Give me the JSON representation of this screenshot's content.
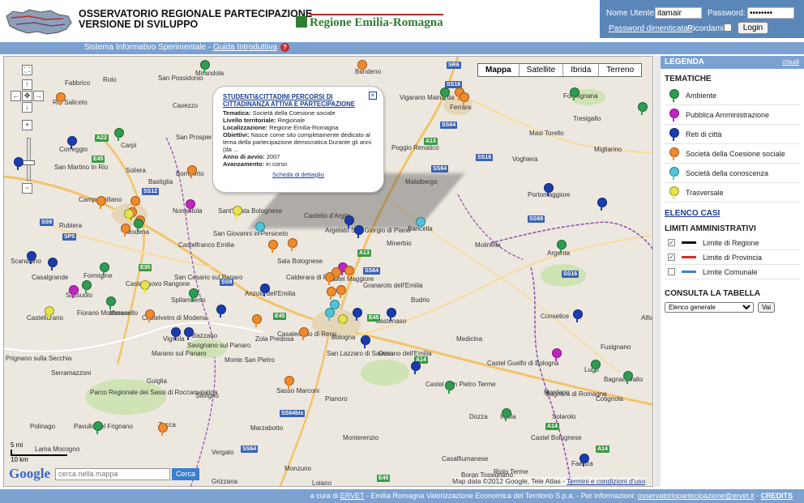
{
  "header": {
    "title_line1": "OSSERVATORIO REGIONALE PARTECIPAZIONE",
    "title_line2": "VERSIONE DI SVILUPPO",
    "region_logo": "Regione Emilia-Romagna"
  },
  "login": {
    "user_label": "Nome Utente:",
    "user_value": "itamair",
    "password_label": "Password:",
    "password_value": "••••••••",
    "forgot_link": "Password dimenticata?",
    "remember_label": "Ricordami:",
    "submit_label": "Login"
  },
  "subbar": {
    "text": "Sistema Informativo Sperimentale - ",
    "guide_link": "Guida Introduttiva",
    "help_icon": "?"
  },
  "map": {
    "type_buttons": [
      "Mappa",
      "Satellite",
      "Ibrida",
      "Terreno"
    ],
    "popup": {
      "title": "STUDENTI&CITTADINI PERCORSI DI CITTADINANZA ATTIVA E PARTECIPAZIONE",
      "tematica_label": "Tematica:",
      "tematica": "Società della Coesione sociale",
      "livello_label": "Livello territoriale:",
      "livello": "Regionale",
      "loc_label": "Localizzazione:",
      "loc": "Regione Emilia-Romagna",
      "obiettivi_label": "Obiettivi:",
      "obiettivi": "Nasce come sito completamente dedicato al tema della partecipazione democratica.Durante gli anni (da ...",
      "anno_label": "Anno di avvio:",
      "anno": "2007",
      "avanz_label": "Avanzamento:",
      "avanz": "in corso",
      "detail_link": "Scheda di dettaglio"
    },
    "search_placeholder": "cerca nella mappa",
    "search_button": "Cerca",
    "google_logo": "Google",
    "scale_mi": "5 mi",
    "scale_km": "10 km",
    "attribution": "Map data ©2012 Google, Tele Atlas - ",
    "terms_link": "Termini e condizioni d'uso",
    "towns": [
      [
        "Fabbrico",
        75,
        28
      ],
      [
        "Rolo",
        122,
        24
      ],
      [
        "San Possidonio",
        190,
        22
      ],
      [
        "Mirandola",
        236,
        16
      ],
      [
        "Bondeno",
        433,
        14
      ],
      [
        "Rio Saliceto",
        60,
        52
      ],
      [
        "Cavezzo",
        208,
        56
      ],
      [
        "San Felice sul Panaro",
        275,
        50
      ],
      [
        "Finale Emilia",
        370,
        50
      ],
      [
        "Vigarano Mainarda",
        488,
        46
      ],
      [
        "Ferrara",
        550,
        58
      ],
      [
        "Formignana",
        690,
        44
      ],
      [
        "Correggio",
        68,
        110
      ],
      [
        "Carpi",
        144,
        105
      ],
      [
        "San Prospero",
        212,
        95
      ],
      [
        "Massa Finalese",
        342,
        78
      ],
      [
        "Poggio Renatico",
        478,
        108
      ],
      [
        "Masi Torello",
        648,
        90
      ],
      [
        "Migliarino",
        728,
        110
      ],
      [
        "Tresigallo",
        702,
        72
      ],
      [
        "Soliera",
        150,
        136
      ],
      [
        "Bastiglia",
        178,
        150
      ],
      [
        "Bomporto",
        212,
        140
      ],
      [
        "Cento",
        405,
        130
      ],
      [
        "Malalbergo",
        495,
        150
      ],
      [
        "Voghiera",
        627,
        122
      ],
      [
        "San Martino In Rio",
        62,
        132
      ],
      [
        "Campogalliano",
        92,
        172
      ],
      [
        "Nonantola",
        208,
        186
      ],
      [
        "San Giovanni in Persiceto",
        258,
        214
      ],
      [
        "Castello d'Argile",
        370,
        192
      ],
      [
        "San Giorgio di Piano",
        428,
        210
      ],
      [
        "Baricella",
        498,
        208
      ],
      [
        "Portomaggiore",
        646,
        166
      ],
      [
        "Rubiera",
        68,
        204
      ],
      [
        "Modena",
        150,
        212
      ],
      [
        "Sant'Agata Bolognese",
        264,
        186
      ],
      [
        "Argelato",
        396,
        210
      ],
      [
        "Minerbio",
        472,
        226
      ],
      [
        "Molinella",
        581,
        228
      ],
      [
        "Argenta",
        670,
        238
      ],
      [
        "Castelfranco Emilia",
        215,
        228
      ],
      [
        "Sala Bolognese",
        337,
        248
      ],
      [
        "Calderara di Reno",
        348,
        268
      ],
      [
        "Granarolo dell'Emilia",
        443,
        278
      ],
      [
        "Budrio",
        502,
        296
      ],
      [
        "Conselice",
        662,
        316
      ],
      [
        "Scandiano",
        8,
        248
      ],
      [
        "Casalgrande",
        34,
        268
      ],
      [
        "Formigine",
        98,
        266
      ],
      [
        "Castelnuovo Rangone",
        150,
        276
      ],
      [
        "San Cesario sul Panaro",
        210,
        268
      ],
      [
        "Castel Maggiore",
        398,
        270
      ],
      [
        "Sassuolo",
        76,
        290
      ],
      [
        "Fiorano Modenese",
        90,
        312
      ],
      [
        "Maranello",
        130,
        312
      ],
      [
        "Spilamberto",
        206,
        296
      ],
      [
        "Anzola dell'Emilia",
        297,
        288
      ],
      [
        "Castelvetro di Modena",
        170,
        318
      ],
      [
        "Castenaso",
        458,
        322
      ],
      [
        "Medicina",
        558,
        344
      ],
      [
        "Imola",
        612,
        440
      ],
      [
        "Castellarano",
        28,
        318
      ],
      [
        "Vignola",
        196,
        344
      ],
      [
        "Bazzano",
        232,
        340
      ],
      [
        "Zola Predosa",
        310,
        344
      ],
      [
        "Casalecchio di Reno",
        337,
        338
      ],
      [
        "Bologna",
        404,
        342
      ],
      [
        "San Lazzaro di Savena",
        398,
        362
      ],
      [
        "Ozzano dell'Emilia",
        462,
        362
      ],
      [
        "Castel Guelfo di Bologna",
        596,
        374
      ],
      [
        "Lugo",
        716,
        382
      ],
      [
        "Bagnacavallo",
        740,
        394
      ],
      [
        "Prignano sulla Secchia",
        2,
        368
      ],
      [
        "Marano sul Panaro",
        182,
        362
      ],
      [
        "Savignano sul Panaro",
        226,
        352
      ],
      [
        "Monte San Pietro",
        272,
        370
      ],
      [
        "Serramazzoni",
        58,
        386
      ],
      [
        "Castel San Pietro Terme",
        520,
        400
      ],
      [
        "Mordano",
        666,
        410
      ],
      [
        "Bagnara di Romagna",
        668,
        412
      ],
      [
        "Cotignola",
        730,
        418
      ],
      [
        "Guiglia",
        176,
        396
      ],
      [
        "Sasso Marconi",
        336,
        408
      ],
      [
        "Pianoro",
        396,
        418
      ],
      [
        "Parco Regionale dei Sassi di Roccamalatina",
        106,
        410
      ],
      [
        "Savigno",
        236,
        414
      ],
      [
        "Dozza",
        574,
        440
      ],
      [
        "Solarolo",
        676,
        440
      ],
      [
        "Polinago",
        32,
        452
      ],
      [
        "Pavullo nel Frignano",
        86,
        452
      ],
      [
        "Zocca",
        190,
        450
      ],
      [
        "Marzabotto",
        304,
        454
      ],
      [
        "Monterenzio",
        418,
        466
      ],
      [
        "Castel Bolognese",
        650,
        466
      ],
      [
        "Faenza",
        700,
        498
      ],
      [
        "Lama Mocogno",
        38,
        480
      ],
      [
        "Vergato",
        256,
        484
      ],
      [
        "Monzuno",
        346,
        504
      ],
      [
        "Casalfiumanese",
        540,
        492
      ],
      [
        "Borgo Tossignano",
        564,
        512
      ],
      [
        "Riolo Terme",
        604,
        508
      ],
      [
        "Grizzana",
        256,
        520
      ],
      [
        "Loiano",
        380,
        522
      ],
      [
        "Fusignano",
        736,
        354
      ],
      [
        "Alfonsine",
        786,
        318
      ]
    ],
    "shields": [
      [
        "SR6",
        546,
        6,
        "b"
      ],
      [
        "SS16",
        544,
        30,
        "b"
      ],
      [
        "A22",
        112,
        96,
        "g"
      ],
      [
        "E45",
        108,
        122,
        "g"
      ],
      [
        "SS12",
        170,
        162,
        "b"
      ],
      [
        "SS9",
        44,
        200,
        "b"
      ],
      [
        "SP5",
        72,
        218,
        "b"
      ],
      [
        "A13",
        518,
        100,
        "g"
      ],
      [
        "SS64",
        538,
        80,
        "b"
      ],
      [
        "SS16",
        582,
        120,
        "b"
      ],
      [
        "SS64",
        527,
        134,
        "b"
      ],
      [
        "SS68",
        646,
        196,
        "b"
      ],
      [
        "A13",
        436,
        238,
        "g"
      ],
      [
        "SS64",
        443,
        260,
        "b"
      ],
      [
        "E35",
        166,
        256,
        "g"
      ],
      [
        "SS9",
        266,
        274,
        "b"
      ],
      [
        "E45",
        332,
        316,
        "g"
      ],
      [
        "E45",
        448,
        318,
        "g"
      ],
      [
        "A14",
        506,
        370,
        "g"
      ],
      [
        "A14",
        668,
        452,
        "g"
      ],
      [
        "A14",
        730,
        480,
        "g"
      ],
      [
        "SS16",
        688,
        264,
        "b"
      ],
      [
        "SS64bis",
        340,
        436,
        "b"
      ],
      [
        "SS64",
        292,
        480,
        "b"
      ],
      [
        "E45",
        460,
        516,
        "g"
      ]
    ],
    "pins": [
      [
        "#2e9b52",
        242,
        4
      ],
      [
        "#f08a2b",
        436,
        4
      ],
      [
        "#2e9b52",
        538,
        38
      ],
      [
        "#f08a2b",
        556,
        38
      ],
      [
        "#f08a2b",
        562,
        44
      ],
      [
        "#2e9b52",
        698,
        38
      ],
      [
        "#2e9b52",
        782,
        56
      ],
      [
        "#f08a2b",
        64,
        44
      ],
      [
        "#2e9b52",
        136,
        88
      ],
      [
        "#1a3cb0",
        78,
        98
      ],
      [
        "#1a3cb0",
        12,
        124
      ],
      [
        "#f08a2b",
        226,
        134
      ],
      [
        "#f08a2b",
        114,
        172
      ],
      [
        "#f08a2b",
        156,
        172
      ],
      [
        "#f08a2b",
        152,
        186
      ],
      [
        "#f08a2b",
        162,
        196
      ],
      [
        "#2e9b52",
        160,
        200
      ],
      [
        "#e6e24a",
        148,
        188
      ],
      [
        "#c024c0",
        224,
        176
      ],
      [
        "#e6e24a",
        282,
        184
      ],
      [
        "#f08a2b",
        144,
        206
      ],
      [
        "#1a3cb0",
        666,
        156
      ],
      [
        "#1a3cb0",
        732,
        174
      ],
      [
        "#1a3cb0",
        420,
        196
      ],
      [
        "#1a3cb0",
        432,
        208
      ],
      [
        "#4ec4d8",
        508,
        198
      ],
      [
        "#4ec4d8",
        310,
        204
      ],
      [
        "#f08a2b",
        326,
        226
      ],
      [
        "#f08a2b",
        350,
        224
      ],
      [
        "#2e9b52",
        682,
        226
      ],
      [
        "#1a3cb0",
        28,
        240
      ],
      [
        "#1a3cb0",
        54,
        248
      ],
      [
        "#2e9b52",
        118,
        254
      ],
      [
        "#c024c0",
        412,
        254
      ],
      [
        "#f08a2b",
        420,
        258
      ],
      [
        "#f08a2b",
        396,
        266
      ],
      [
        "#f08a2b",
        404,
        260
      ],
      [
        "#c024c0",
        80,
        282
      ],
      [
        "#2e9b52",
        96,
        276
      ],
      [
        "#e6e24a",
        168,
        276
      ],
      [
        "#2e9b52",
        228,
        286
      ],
      [
        "#1a3cb0",
        316,
        280
      ],
      [
        "#1a3cb0",
        262,
        306
      ],
      [
        "#f08a2b",
        174,
        312
      ],
      [
        "#2e9b52",
        126,
        296
      ],
      [
        "#e6e24a",
        50,
        308
      ],
      [
        "#f08a2b",
        398,
        284
      ],
      [
        "#f08a2b",
        410,
        282
      ],
      [
        "#4ec4d8",
        402,
        300
      ],
      [
        "#4ec4d8",
        396,
        310
      ],
      [
        "#e6e24a",
        412,
        318
      ],
      [
        "#1a3cb0",
        430,
        310
      ],
      [
        "#1a3cb0",
        472,
        310
      ],
      [
        "#1a3cb0",
        702,
        312
      ],
      [
        "#1a3cb0",
        206,
        334
      ],
      [
        "#1a3cb0",
        222,
        334
      ],
      [
        "#f08a2b",
        306,
        318
      ],
      [
        "#f08a2b",
        364,
        334
      ],
      [
        "#1a3cb0",
        440,
        344
      ],
      [
        "#1a3cb0",
        502,
        376
      ],
      [
        "#2e9b52",
        724,
        374
      ],
      [
        "#2e9b52",
        764,
        388
      ],
      [
        "#c024c0",
        676,
        360
      ],
      [
        "#f08a2b",
        346,
        394
      ],
      [
        "#2e9b52",
        544,
        400
      ],
      [
        "#2e9b52",
        614,
        434
      ],
      [
        "#2e9b52",
        110,
        450
      ],
      [
        "#f08a2b",
        190,
        452
      ],
      [
        "#1a3cb0",
        710,
        490
      ]
    ]
  },
  "legend": {
    "title": "LEGENDA",
    "close_link": "chiudi",
    "tematiche_heading": "TEMATICHE",
    "tematiche": [
      {
        "label": "Ambiente",
        "color": "#2e9b52"
      },
      {
        "label": "Pubblica Amministrazione",
        "color": "#c024c0"
      },
      {
        "label": "Reti di città",
        "color": "#1a3cb0"
      },
      {
        "label": "Società della Coesione sociale",
        "color": "#f08a2b"
      },
      {
        "label": "Società della conoscenza",
        "color": "#4ec4d8"
      },
      {
        "label": "Trasversale",
        "color": "#e6e24a"
      }
    ],
    "elenco_link": "ELENCO CASI",
    "limiti_heading": "LIMITI AMMINISTRATIVI",
    "limiti": [
      {
        "label": "Limite di Regione",
        "checked": true,
        "color": "#111111"
      },
      {
        "label": "Limite di Provincia",
        "checked": true,
        "color": "#d32f2f"
      },
      {
        "label": "Limite Comunale",
        "checked": false,
        "color": "#3f7fd1"
      }
    ],
    "tabella_heading": "CONSULTA LA TABELLA",
    "select_value": "Elenco generale",
    "vai_label": "Vai"
  },
  "footer": {
    "prefix": "a cura di ",
    "ervet_link": "ERVET",
    "middle": " - Emilia Romagna Valorizzazione Economica del Territorio S.p.a. - Per informazioni: ",
    "email_link": "osservatoriopartecipazione@ervet.it",
    "sep": " - ",
    "credits_link": "CREDITS"
  }
}
